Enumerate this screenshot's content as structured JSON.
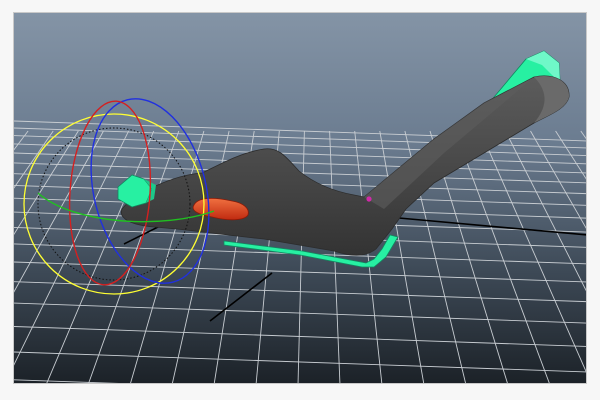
{
  "viewport": {
    "background_top": "#8494a6",
    "background_bottom": "#1c2228",
    "grid_color": "#c8cdd2",
    "grid_axis_color": "#000000"
  },
  "scene": {
    "mesh_color": "#4a4a4a",
    "control_curve_color": "#27f0a2",
    "selected_object_color": "#e2461a",
    "pivot_color": "#d02aa8"
  },
  "rotate_manipulator": {
    "outer_ring_color": "#ffff33",
    "x_axis_color": "#d42020",
    "y_axis_color": "#20c020",
    "z_axis_color": "#2030e0"
  }
}
